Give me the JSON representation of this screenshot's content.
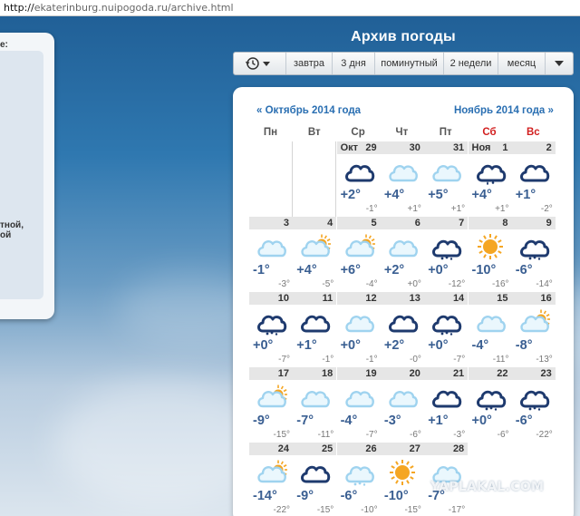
{
  "browser": {
    "url_proto": "http://",
    "url_rest": "ekaterinburg.nuipogoda.ru/archive.html"
  },
  "side_panel": {
    "text_top": "e:",
    "text_mid1": "тной,",
    "text_mid2": "ой"
  },
  "header": {
    "title": "Архив погоды"
  },
  "toolbar": {
    "history_icon": "history-clock-icon",
    "tomorrow": "завтра",
    "three_days": "3 дня",
    "minutely": "поминутный",
    "two_weeks": "2 недели",
    "month": "месяц"
  },
  "calendar": {
    "prev_month": "« Октябрь 2014 года",
    "next_month": "Ноябрь 2014 года »",
    "weekdays": [
      "Пн",
      "Вт",
      "Ср",
      "Чт",
      "Пт",
      "Сб",
      "Вс"
    ],
    "colors": {
      "weekend": "#d21f1f",
      "cloud_dark": "#1e3a6e",
      "cloud_light": "#9fd3ef",
      "sun": "#f5a623",
      "temp": "#3a5f92"
    },
    "days": [
      {
        "col": 2,
        "row": 0,
        "num": "29",
        "mon": "Окт",
        "icon": "cloud-dark-icon",
        "max": "+2°",
        "min": "-1°"
      },
      {
        "col": 3,
        "row": 0,
        "num": "30",
        "icon": "cloud-light-icon",
        "max": "+4°",
        "min": "+1°"
      },
      {
        "col": 4,
        "row": 0,
        "num": "31",
        "icon": "cloud-light-icon",
        "max": "+5°",
        "min": "+1°"
      },
      {
        "col": 5,
        "row": 0,
        "num": "1",
        "mon": "Ноя",
        "icon": "cloud-dark-rain-icon",
        "max": "+4°",
        "min": "+1°"
      },
      {
        "col": 6,
        "row": 0,
        "num": "2",
        "icon": "cloud-dark-icon",
        "max": "+1°",
        "min": "-2°"
      },
      {
        "col": 0,
        "row": 1,
        "num": "3",
        "icon": "cloud-light-icon",
        "max": "-1°",
        "min": "-3°"
      },
      {
        "col": 1,
        "row": 1,
        "num": "4",
        "icon": "cloud-sun-icon",
        "max": "+4°",
        "min": "-5°"
      },
      {
        "col": 2,
        "row": 1,
        "num": "5",
        "icon": "cloud-sun-icon",
        "max": "+6°",
        "min": "-4°"
      },
      {
        "col": 3,
        "row": 1,
        "num": "6",
        "icon": "cloud-light-icon",
        "max": "+2°",
        "min": "+0°"
      },
      {
        "col": 4,
        "row": 1,
        "num": "7",
        "icon": "cloud-dark-snow-icon",
        "max": "+0°",
        "min": "-12°"
      },
      {
        "col": 5,
        "row": 1,
        "num": "8",
        "icon": "sun-icon",
        "max": "-10°",
        "min": "-16°"
      },
      {
        "col": 6,
        "row": 1,
        "num": "9",
        "icon": "cloud-dark-snow-icon",
        "max": "-6°",
        "min": "-14°"
      },
      {
        "col": 0,
        "row": 2,
        "num": "10",
        "icon": "cloud-dark-snow-icon",
        "max": "+0°",
        "min": "-7°"
      },
      {
        "col": 1,
        "row": 2,
        "num": "11",
        "icon": "cloud-dark-icon",
        "max": "+1°",
        "min": "-1°"
      },
      {
        "col": 2,
        "row": 2,
        "num": "12",
        "icon": "cloud-light-icon",
        "max": "+0°",
        "min": "-1°"
      },
      {
        "col": 3,
        "row": 2,
        "num": "13",
        "icon": "cloud-dark-icon",
        "max": "+2°",
        "min": "-0°"
      },
      {
        "col": 4,
        "row": 2,
        "num": "14",
        "icon": "cloud-dark-snow-icon",
        "max": "+0°",
        "min": "-7°"
      },
      {
        "col": 5,
        "row": 2,
        "num": "15",
        "icon": "cloud-light-icon",
        "max": "-4°",
        "min": "-11°"
      },
      {
        "col": 6,
        "row": 2,
        "num": "16",
        "icon": "cloud-sun-icon",
        "max": "-8°",
        "min": "-13°"
      },
      {
        "col": 0,
        "row": 3,
        "num": "17",
        "icon": "cloud-sun-icon",
        "max": "-9°",
        "min": "-15°"
      },
      {
        "col": 1,
        "row": 3,
        "num": "18",
        "icon": "cloud-light-icon",
        "max": "-7°",
        "min": "-11°"
      },
      {
        "col": 2,
        "row": 3,
        "num": "19",
        "icon": "cloud-light-icon",
        "max": "-4°",
        "min": "-7°"
      },
      {
        "col": 3,
        "row": 3,
        "num": "20",
        "icon": "cloud-light-icon",
        "max": "-3°",
        "min": "-6°"
      },
      {
        "col": 4,
        "row": 3,
        "num": "21",
        "icon": "cloud-dark-icon",
        "max": "+1°",
        "min": "-3°"
      },
      {
        "col": 5,
        "row": 3,
        "num": "22",
        "icon": "cloud-dark-snow-icon",
        "max": "+0°",
        "min": "-6°"
      },
      {
        "col": 6,
        "row": 3,
        "num": "23",
        "icon": "cloud-dark-snow-icon",
        "max": "-6°",
        "min": "-22°"
      },
      {
        "col": 0,
        "row": 4,
        "num": "24",
        "icon": "cloud-sun-icon",
        "max": "-14°",
        "min": "-22°"
      },
      {
        "col": 1,
        "row": 4,
        "num": "25",
        "icon": "cloud-dark-icon",
        "max": "-9°",
        "min": "-15°"
      },
      {
        "col": 2,
        "row": 4,
        "num": "26",
        "icon": "cloud-light-snow-icon",
        "max": "-6°",
        "min": "-10°"
      },
      {
        "col": 3,
        "row": 4,
        "num": "27",
        "icon": "sun-icon",
        "max": "-10°",
        "min": "-15°"
      },
      {
        "col": 4,
        "row": 4,
        "num": "28",
        "icon": "cloud-light-icon",
        "max": "-7°",
        "min": "-17°"
      }
    ]
  },
  "watermark": "YAPLAKAL.COM"
}
